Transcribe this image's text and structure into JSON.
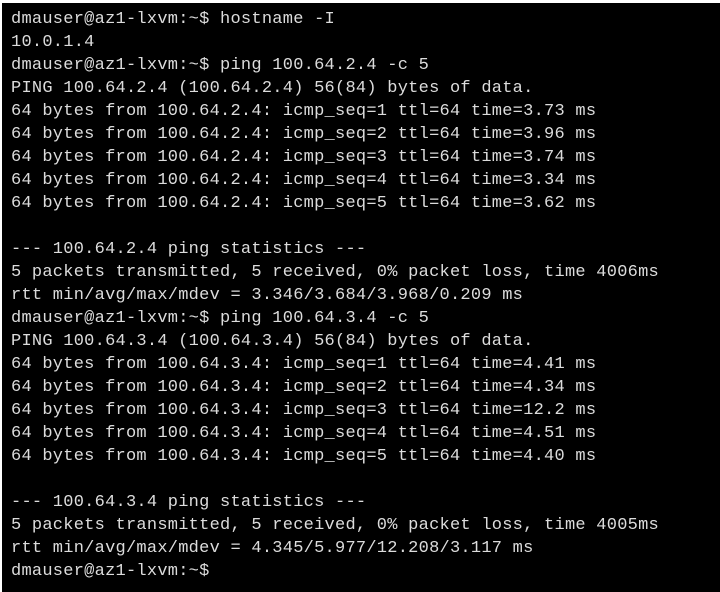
{
  "terminal": {
    "lines": [
      "dmauser@az1-lxvm:~$ hostname -I",
      "10.0.1.4",
      "dmauser@az1-lxvm:~$ ping 100.64.2.4 -c 5",
      "PING 100.64.2.4 (100.64.2.4) 56(84) bytes of data.",
      "64 bytes from 100.64.2.4: icmp_seq=1 ttl=64 time=3.73 ms",
      "64 bytes from 100.64.2.4: icmp_seq=2 ttl=64 time=3.96 ms",
      "64 bytes from 100.64.2.4: icmp_seq=3 ttl=64 time=3.74 ms",
      "64 bytes from 100.64.2.4: icmp_seq=4 ttl=64 time=3.34 ms",
      "64 bytes from 100.64.2.4: icmp_seq=5 ttl=64 time=3.62 ms",
      "",
      "--- 100.64.2.4 ping statistics ---",
      "5 packets transmitted, 5 received, 0% packet loss, time 4006ms",
      "rtt min/avg/max/mdev = 3.346/3.684/3.968/0.209 ms",
      "dmauser@az1-lxvm:~$ ping 100.64.3.4 -c 5",
      "PING 100.64.3.4 (100.64.3.4) 56(84) bytes of data.",
      "64 bytes from 100.64.3.4: icmp_seq=1 ttl=64 time=4.41 ms",
      "64 bytes from 100.64.3.4: icmp_seq=2 ttl=64 time=4.34 ms",
      "64 bytes from 100.64.3.4: icmp_seq=3 ttl=64 time=12.2 ms",
      "64 bytes from 100.64.3.4: icmp_seq=4 ttl=64 time=4.51 ms",
      "64 bytes from 100.64.3.4: icmp_seq=5 ttl=64 time=4.40 ms",
      "",
      "--- 100.64.3.4 ping statistics ---",
      "5 packets transmitted, 5 received, 0% packet loss, time 4005ms",
      "rtt min/avg/max/mdev = 4.345/5.977/12.208/3.117 ms",
      "dmauser@az1-lxvm:~$"
    ]
  },
  "colors": {
    "background": "#000000",
    "foreground": "#dcdcdc"
  }
}
